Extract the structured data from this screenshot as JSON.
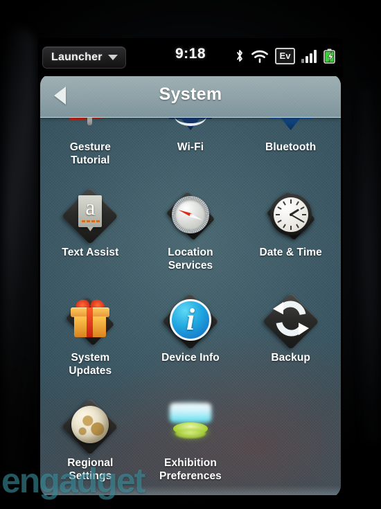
{
  "statusbar": {
    "launcher_label": "Launcher",
    "launcher_caret": "chevron-down-icon",
    "time": "9:18",
    "icons": [
      {
        "name": "bluetooth-icon",
        "label": "Bluetooth"
      },
      {
        "name": "wifi-icon",
        "label": "Wi-Fi"
      },
      {
        "name": "evdo-icon",
        "label": "Ev"
      },
      {
        "name": "signal-bars-icon",
        "label": "Signal"
      },
      {
        "name": "battery-charging-icon",
        "label": "Battery"
      }
    ]
  },
  "header": {
    "back_icon": "back-arrow-icon",
    "title": "System"
  },
  "grid": {
    "items": [
      {
        "label": "Gesture\nTutorial",
        "line1": "Gesture",
        "line2": "Tutorial",
        "icon": "gesture-tutorial-icon"
      },
      {
        "label": "Wi-Fi",
        "line1": "Wi-Fi",
        "line2": "",
        "icon": "wifi-settings-icon"
      },
      {
        "label": "Bluetooth",
        "line1": "Bluetooth",
        "line2": "",
        "icon": "bluetooth-settings-icon"
      },
      {
        "label": "Text Assist",
        "line1": "Text Assist",
        "line2": "",
        "icon": "text-assist-icon"
      },
      {
        "label": "Location\nServices",
        "line1": "Location",
        "line2": "Services",
        "icon": "location-services-icon"
      },
      {
        "label": "Date & Time",
        "line1": "Date & Time",
        "line2": "",
        "icon": "date-time-icon"
      },
      {
        "label": "System\nUpdates",
        "line1": "System",
        "line2": "Updates",
        "icon": "system-updates-icon"
      },
      {
        "label": "Device Info",
        "line1": "Device Info",
        "line2": "",
        "icon": "device-info-icon"
      },
      {
        "label": "Backup",
        "line1": "Backup",
        "line2": "",
        "icon": "backup-icon"
      },
      {
        "label": "Regional\nSettings",
        "line1": "Regional",
        "line2": "Settings",
        "icon": "regional-settings-icon"
      },
      {
        "label": "Exhibition\nPreferences",
        "line1": "Exhibition",
        "line2": "Preferences",
        "icon": "exhibition-preferences-icon"
      }
    ]
  },
  "watermark": {
    "text": "engadget"
  },
  "colors": {
    "panel_bg": "#3d5a66",
    "header_bar": "#8ca0a6",
    "label_text": "#ffffff",
    "accent_blue": "#1fa7e0",
    "battery_green": "#3ecf3e",
    "watermark_teal": "#3fa0b0"
  }
}
